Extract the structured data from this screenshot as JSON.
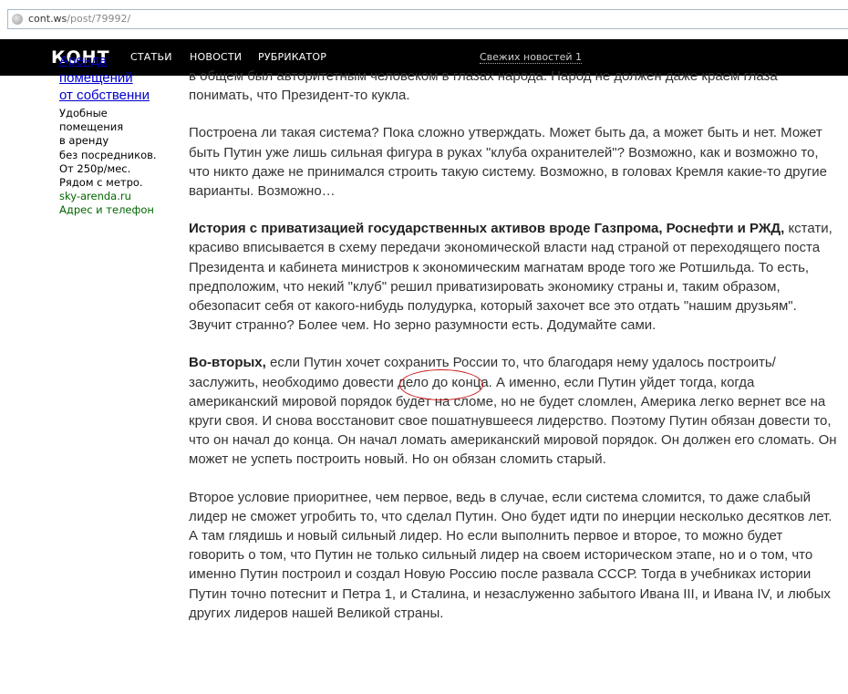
{
  "browser": {
    "url_host": "cont.ws",
    "url_path": "/post/79992/"
  },
  "nav": {
    "logo": "КОНТ",
    "items": [
      "СТАТЬИ",
      "НОВОСТИ",
      "РУБРИКАТОР"
    ],
    "fresh_news": "Свежих новостей 1"
  },
  "ad": {
    "title_lines": [
      "Аренда",
      "помещений",
      "от собственни"
    ],
    "text_lines": [
      "Удобные",
      "помещения",
      "в аренду",
      "без посредников.",
      "От 250р/мес.",
      "Рядом с метро."
    ],
    "host": "sky-arenda.ru",
    "contact": "Адрес и телефон"
  },
  "article": {
    "p1": "в общем был авторитетным человеком в глазах народа. Народ не должен даже краем глаза понимать, что Президент-то кукла.",
    "p2": "Построена ли такая система? Пока сложно утверждать. Может быть да, а может быть и нет. Может быть Путин уже лишь сильная фигура в руках \"клуба охранителей\"? Возможно, как и возможно то, что никто даже не принимался строить такую систему. Возможно, в головах Кремля какие-то другие варианты. Возможно…",
    "p3_bold": "История с приватизацией государственных активов вроде Газпрома, Роснефти и РЖД,",
    "p3_rest": " кстати, красиво вписывается в схему передачи экономической власти над страной от переходящего поста Президента и кабинета министров к экономическим магнатам вроде того же Ротшильда. То есть, предположим, что некий \"клуб\" решил приватизировать экономику страны и, таким образом, обезопасит себя от какого-нибудь полудурка, который захочет все это отдать \"нашим друзьям\". Звучит странно? Более чем. Но зерно разумности есть. Додумайте сами.",
    "p4_bold": "Во-вторых,",
    "p4_rest": " если Путин хочет сохранить России то, что благодаря нему удалось построить/заслужить, необходимо довести дело до конца. А именно, если Путин уйдет тогда, когда американский мировой порядок будет на сломе, но не будет сломлен, Америка легко вернет все на круги своя. И снова восстановит свое пошатнувшееся лидерство. Поэтому Путин обязан довести то, что он начал до конца. Он начал ломать американский мировой порядок. Он должен его сломать. Он может не успеть построить новый. Но он обязан сломить старый.",
    "p5": "Второе условие приоритнее, чем первое, ведь в случае, если система сломится, то даже слабый лидер не сможет угробить то, что сделал Путин. Оно будет идти по инерции несколько десятков лет. А там глядишь и новый сильный лидер. Но если выполнить первое и второе, то можно будет говорить о том, что Путин не только сильный лидер на своем историческом этапе, но и о том, что именно Путин построил и создал Новую Россию после развала СССР. Тогда в учебниках истории Путин точно потеснит и Петра 1, и Сталина, и незаслуженно забытого Ивана III, и Ивана IV, и любых других лидеров нашей Великой страны."
  },
  "colors": {
    "nav_bg": "#000000",
    "ad_link": "#0000cc",
    "ad_host": "#006600",
    "annotation": "#cc1a1a"
  }
}
